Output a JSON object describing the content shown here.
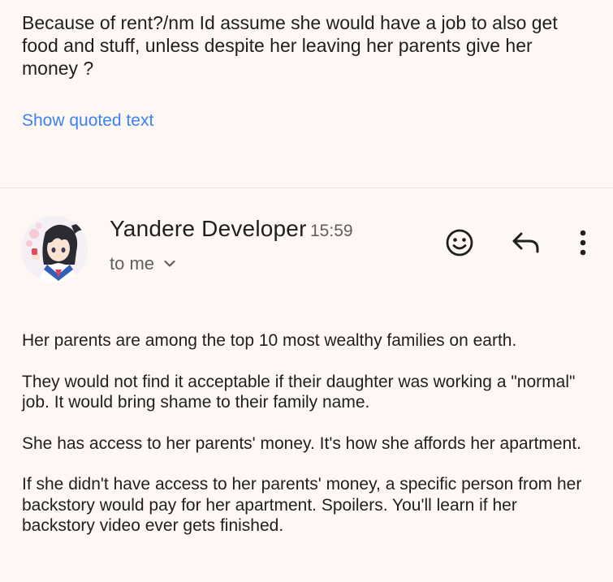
{
  "previous_message": {
    "body": "Because of rent?/nm Id assume she would have a job to also get food and stuff, unless despite her leaving her parents give her money ?",
    "show_quoted_label": "Show quoted text"
  },
  "message": {
    "sender_name": "Yandere Developer",
    "time": "15:59",
    "recipient_label": "to me",
    "avatar_icon": "anime-character-avatar",
    "actions": {
      "react_icon": "smiley-face-icon",
      "reply_icon": "reply-arrow-icon",
      "more_icon": "vertical-dots-icon"
    },
    "paragraphs": [
      "Her parents are among the top 10 most wealthy families on earth.",
      "They would not find it acceptable if their daughter was working a \"normal\" job. It would bring shame to their family name.",
      "She has access to her parents' money. It's how she affords her apartment.",
      "If she didn't have access to her parents' money, a specific person from her backstory would pay for her apartment. Spoilers. You'll learn if her backstory video ever gets finished."
    ]
  },
  "colors": {
    "background": "#fff7f4",
    "link": "#3b82f6",
    "text": "#1f1f1f",
    "secondary_text": "#5f5f5f"
  }
}
